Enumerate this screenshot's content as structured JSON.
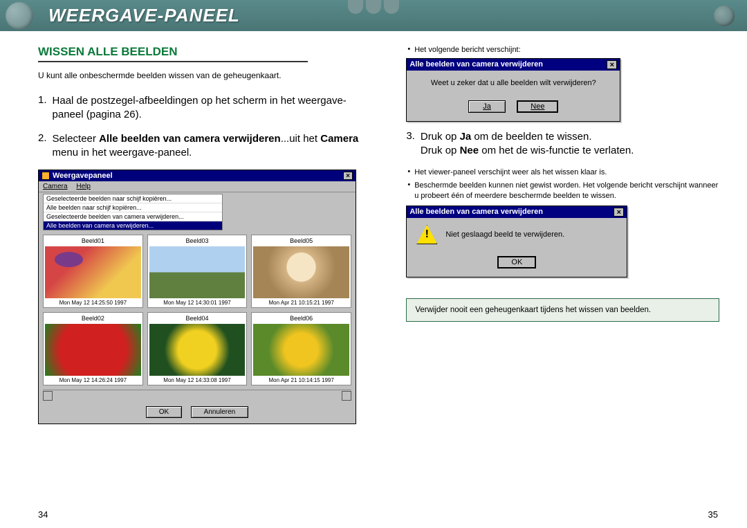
{
  "header": {
    "title": "WEERGAVE-PANEEL"
  },
  "section": {
    "title": "WISSEN ALLE BEELDEN",
    "intro": "U kunt alle onbeschermde beelden wissen van de geheugenkaart."
  },
  "steps": {
    "s1": {
      "num": "1.",
      "text": "Haal de postzegel-afbeeldingen op het scherm in het weergave-paneel (pagina 26)."
    },
    "s2": {
      "num": "2.",
      "pre": "Selecteer ",
      "bold1": "Alle beelden van camera verwijderen",
      "mid": "...uit het ",
      "bold2": "Camera",
      "post": " menu in het weergave-paneel."
    },
    "s3": {
      "num": "3.",
      "l1a": "Druk op ",
      "l1b": "Ja",
      "l1c": " om de beelden te wissen.",
      "l2a": "Druk op ",
      "l2b": "Nee",
      "l2c": " om het de wis-functie te verlaten."
    }
  },
  "bullets": {
    "b1": "Het volgende bericht verschijnt:",
    "b2": "Het viewer-paneel verschijnt weer als het wissen klaar is.",
    "b3": "Beschermde beelden kunnen niet gewist worden. Het volgende bericht verschijnt wanneer u probeert één of meerdere beschermde beelden te wissen."
  },
  "shot1": {
    "title": "Weergavepaneel",
    "menu": {
      "m1": "Camera",
      "m2": "Help"
    },
    "dropdown": {
      "d1": "Geselecteerde beelden naar schijf kopiëren...",
      "d2": "Alle beelden naar schijf kopiëren...",
      "d3": "Geselecteerde beelden van camera verwijderen...",
      "d4": "Alle beelden van camera verwijderen..."
    },
    "thumbs": [
      {
        "label": "Beeld01",
        "date": "Mon May 12 14:25:50 1997",
        "cls": "img-fruit"
      },
      {
        "label": "Beeld03",
        "date": "Mon May 12 14:30:01 1997",
        "cls": "img-castle"
      },
      {
        "label": "Beeld05",
        "date": "Mon Apr 21 10:15:21 1997",
        "cls": "img-hat"
      },
      {
        "label": "Beeld02",
        "date": "Mon May 12 14:26:24 1997",
        "cls": "img-straw"
      },
      {
        "label": "Beeld04",
        "date": "Mon May 12 14:33:08 1997",
        "cls": "img-flower1"
      },
      {
        "label": "Beeld06",
        "date": "Mon Apr 21 10:14:15 1997",
        "cls": "img-flower2"
      }
    ],
    "ok": "OK",
    "cancel": "Annuleren"
  },
  "dialog1": {
    "title": "Alle beelden van camera verwijderen",
    "msg": "Weet u zeker dat u alle beelden wilt verwijderen?",
    "yes": "Ja",
    "no": "Nee"
  },
  "dialog2": {
    "title": "Alle beelden van camera verwijderen",
    "msg": "Niet geslaagd beeld te verwijderen.",
    "ok": "OK"
  },
  "note": "Verwijder nooit een geheugenkaart tijdens het wissen van beelden.",
  "pages": {
    "left": "34",
    "right": "35"
  }
}
